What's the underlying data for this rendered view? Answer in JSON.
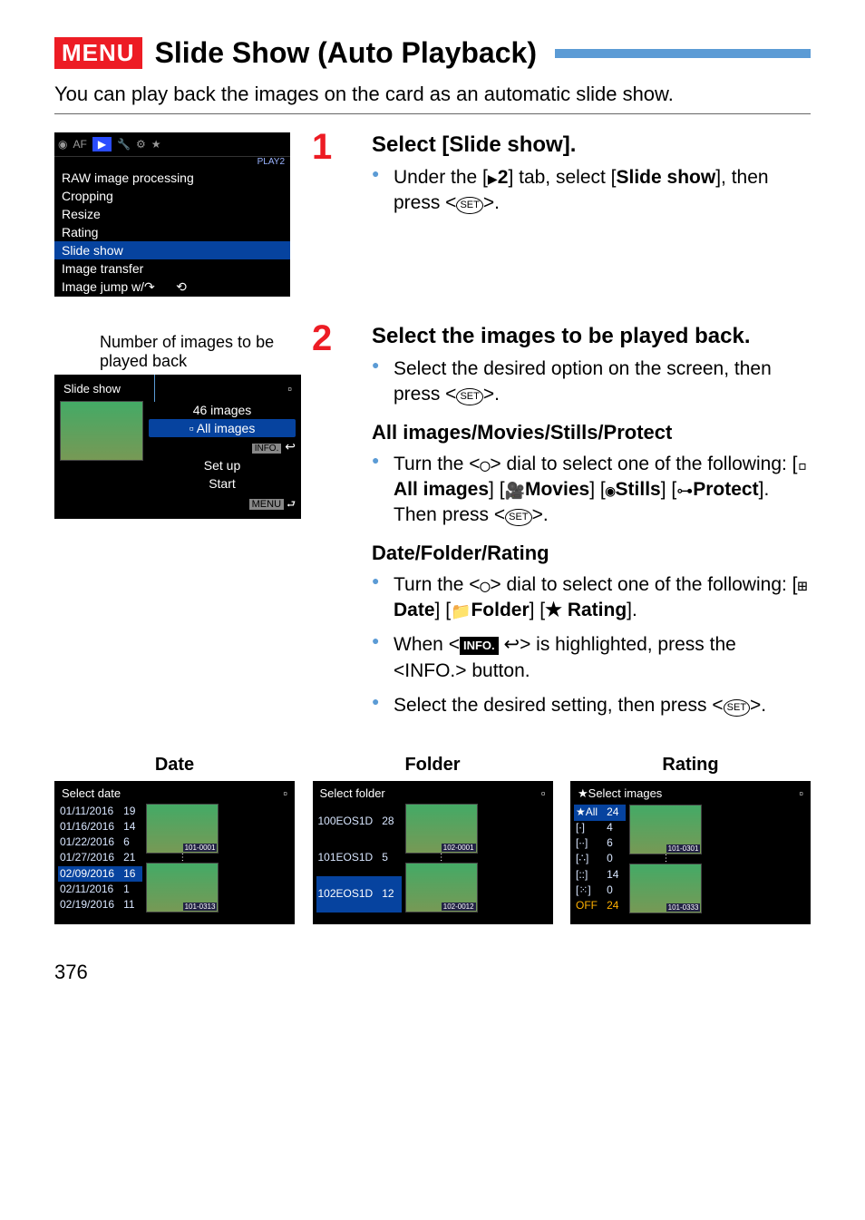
{
  "header": {
    "badge": "MENU",
    "title": "Slide Show (Auto Playback)"
  },
  "intro": "You can play back the images on the card as an automatic slide show.",
  "menu_lcd": {
    "tab_label": "PLAY2",
    "items": [
      "RAW image processing",
      "Cropping",
      "Resize",
      "Rating",
      "Slide show",
      "Image transfer",
      "Image jump w/"
    ],
    "highlight": "Slide show"
  },
  "callout": "Number of images to be played back",
  "slide_lcd": {
    "title": "Slide show",
    "count": "46 images",
    "option_selected": "All images",
    "info_label": "INFO.",
    "opt_setup": "Set up",
    "opt_start": "Start",
    "menu_return": "MENU"
  },
  "steps": {
    "s1": {
      "head": "Select [Slide show].",
      "body": "Under the [▶2] tab, select [Slide show], then press <SET>."
    },
    "s2": {
      "head": "Select the images to be played back.",
      "body1": "Select the desired option on the screen, then press <SET>.",
      "sub1": "All images/Movies/Stills/Protect",
      "body2": "Turn the <◯> dial to select one of the following: [All images] [Movies] [Stills] [Protect]. Then press <SET>.",
      "sub2": "Date/Folder/Rating",
      "body3": "Turn the <◯> dial to select one of the following: [Date] [Folder] [Rating].",
      "body4": "When <INFO. ↩> is highlighted, press the <INFO.> button.",
      "body5": "Select the desired setting, then press <SET>."
    }
  },
  "bottom": {
    "date": {
      "label": "Date",
      "title": "Select date",
      "rows": [
        [
          "01/11/2016",
          "19"
        ],
        [
          "01/16/2016",
          "14"
        ],
        [
          "01/22/2016",
          "6"
        ],
        [
          "01/27/2016",
          "21"
        ],
        [
          "02/09/2016",
          "16"
        ],
        [
          "02/11/2016",
          "1"
        ],
        [
          "02/19/2016",
          "11"
        ]
      ],
      "hl_index": 4,
      "img_top": "101-0001",
      "img_bot": "101-0313"
    },
    "folder": {
      "label": "Folder",
      "title": "Select folder",
      "rows": [
        [
          "100EOS1D",
          "28"
        ],
        [
          "101EOS1D",
          "5"
        ],
        [
          "102EOS1D",
          "12"
        ]
      ],
      "hl_index": 2,
      "img_top": "102-0001",
      "img_bot": "102-0012"
    },
    "rating": {
      "label": "Rating",
      "title": "★Select images",
      "rows": [
        [
          "★All",
          "24"
        ],
        [
          "[∙]",
          "4"
        ],
        [
          "[∙∙]",
          "6"
        ],
        [
          "[∴]",
          "0"
        ],
        [
          "[::]",
          "14"
        ],
        [
          "[⁙]",
          "0"
        ],
        [
          "OFF",
          "24"
        ]
      ],
      "hl_index": 0,
      "img_top": "101-0301",
      "img_bot": "101-0333"
    }
  },
  "page_number": "376"
}
